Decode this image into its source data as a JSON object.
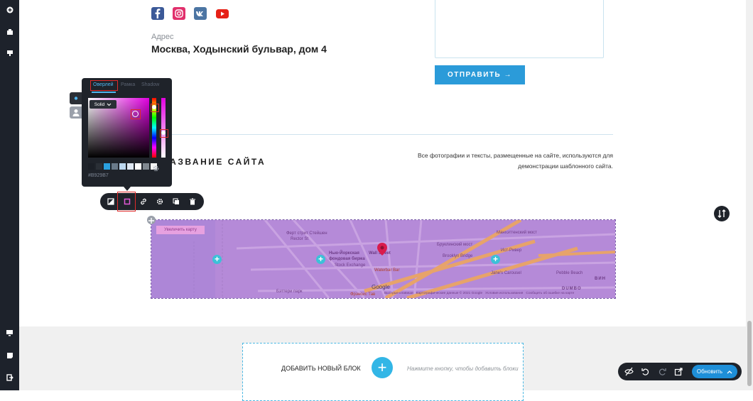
{
  "left_rail": {
    "top_icons": [
      "plus-circle-icon",
      "box-icon",
      "component-icon"
    ],
    "bottom_icons": [
      "monitor-icon",
      "page-icon",
      "exit-icon"
    ]
  },
  "socials": [
    "facebook-icon",
    "instagram-icon",
    "vk-icon",
    "youtube-icon"
  ],
  "contact": {
    "address_label": "Адрес",
    "address_value": "Москва, Ходынский бульвар, дом 4"
  },
  "form": {
    "send_label": "ОТПРАВИТЬ →"
  },
  "footer": {
    "site_title": "НАЗВАНИЕ САЙТА",
    "note_line1": "Все фотографии и тексты, размещенные на сайте, используются для",
    "note_line2": "демонстрации шаблонного сайта."
  },
  "color_picker": {
    "tabs": [
      "Оверлей",
      "Рамка",
      "Shadow"
    ],
    "active_tab": "Оверлей",
    "mode": "Solid",
    "hex_value": "#B929B7",
    "swatches": [
      "#1b1f26",
      "#2a2f36",
      "#2aa0df",
      "#6a7a8a",
      "#bcd7ef",
      "#dfe8f3",
      "#ffffff",
      "#808890",
      "#f5f5f5"
    ],
    "accent": "#4fb4ee"
  },
  "element_toolbar": {
    "buttons": [
      "overlay-icon",
      "border-icon",
      "link-icon",
      "gear-icon",
      "copy-icon",
      "trash-icon"
    ]
  },
  "map": {
    "enlarge_label": "Увеличить карту",
    "labels": {
      "stadt": "Ферт стрит Стейшен",
      "rector": "Rector St",
      "nyse": "Нью-Йоркская",
      "nyse2": "фондовая биржа",
      "nyse3": "Stock Exchange",
      "wall": "Wall Street",
      "waterbar": "Waterbar Bar",
      "brooklyn": "Бруклинский мост",
      "brooklyn2": "Brooklyn Bridge",
      "manhattan": "Манхэттенский мост",
      "east": "Ист-Ривер",
      "janes": "Jane's Carousel",
      "pebble": "Pebble Beach",
      "battery": "Бэттери парк",
      "francis": "Фрэнсис Тав",
      "dumbo": "DUMBO",
      "vin": "ВИН",
      "google": "Google",
      "credits": "Быстрые клавиши   Картографические данные © 2021 Google   Условия использования   Сообщить об ошибке на карте"
    }
  },
  "add_block": {
    "label": "ДОБАВИТЬ НОВЫЙ БЛОК",
    "hint": "Нажмите кнопку, чтобы добавить блоки"
  },
  "update_bar": {
    "icons": [
      "eye-off-icon",
      "undo-icon",
      "redo-icon",
      "external-link-icon"
    ],
    "button_label": "Обновить"
  }
}
